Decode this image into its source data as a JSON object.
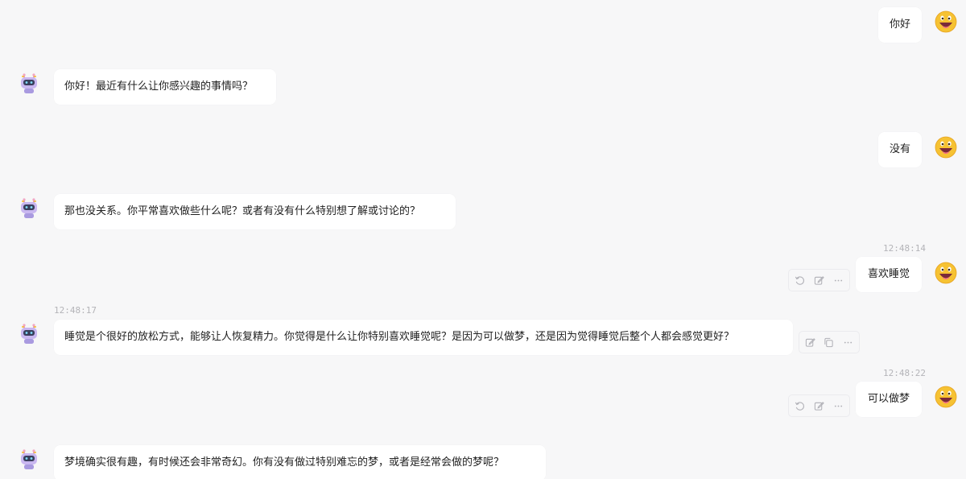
{
  "messages": [
    {
      "role": "user",
      "text": "你好"
    },
    {
      "role": "assistant",
      "text": "你好！最近有什么让你感兴趣的事情吗？"
    },
    {
      "role": "user",
      "text": "没有"
    },
    {
      "role": "assistant",
      "text": "那也没关系。你平常喜欢做些什么呢？或者有没有什么特别想了解或讨论的？"
    },
    {
      "role": "user",
      "text": "喜欢睡觉",
      "timestamp": "12:48:14"
    },
    {
      "role": "assistant",
      "text": "睡觉是个很好的放松方式，能够让人恢复精力。你觉得是什么让你特别喜欢睡觉呢？是因为可以做梦，还是因为觉得睡觉后整个人都会感觉更好？",
      "timestamp": "12:48:17"
    },
    {
      "role": "user",
      "text": "可以做梦",
      "timestamp": "12:48:22"
    },
    {
      "role": "assistant",
      "text": "梦境确实很有趣，有时候还会非常奇幻。你有没有做过特别难忘的梦，或者是经常会做的梦呢？"
    }
  ],
  "icons": {
    "user_avatar": "grinning-face-emoji-icon",
    "assistant_avatar": "robot-icon",
    "user_actions": [
      "retry-icon",
      "edit-icon",
      "more-icon"
    ],
    "assistant_actions": [
      "edit-icon",
      "copy-icon",
      "more-icon"
    ]
  },
  "colors": {
    "background": "#f7f7f8",
    "bubble": "#ffffff",
    "timestamp": "#b4b4b8",
    "emoji_face": "#f6c233",
    "robot_body": "#c9b7f0"
  }
}
